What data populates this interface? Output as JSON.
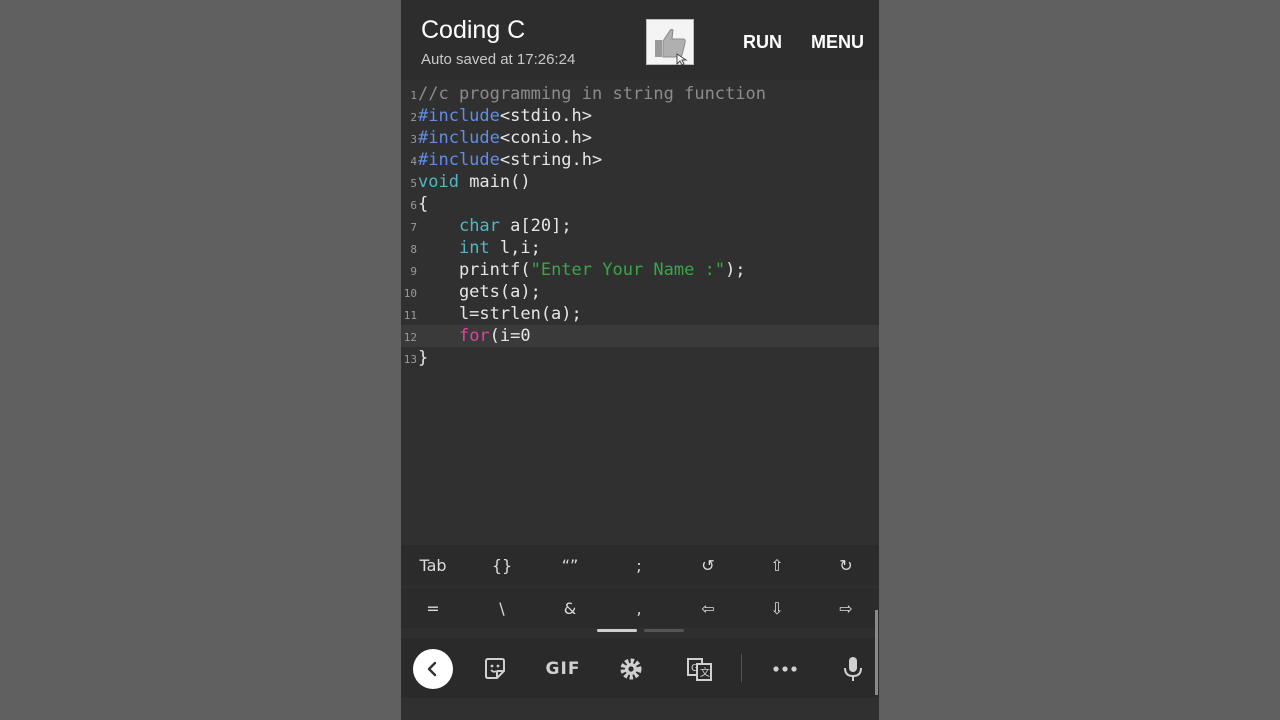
{
  "app": {
    "title": "Coding C",
    "autosave": "Auto saved at 17:26:24"
  },
  "toolbar": {
    "like_icon": "thumbs-up-icon",
    "run_label": "RUN",
    "menu_label": "MENU"
  },
  "editor": {
    "current_line": 12,
    "lines": [
      {
        "n": "1",
        "tokens": [
          {
            "c": "comment",
            "t": "//c programming in string function"
          }
        ]
      },
      {
        "n": "2",
        "tokens": [
          {
            "c": "pre",
            "t": "#include"
          },
          {
            "c": "plain",
            "t": "<stdio.h>"
          }
        ]
      },
      {
        "n": "3",
        "tokens": [
          {
            "c": "pre",
            "t": "#include"
          },
          {
            "c": "plain",
            "t": "<conio.h>"
          }
        ]
      },
      {
        "n": "4",
        "tokens": [
          {
            "c": "pre",
            "t": "#include"
          },
          {
            "c": "plain",
            "t": "<string.h>"
          }
        ]
      },
      {
        "n": "5",
        "tokens": [
          {
            "c": "type",
            "t": "void"
          },
          {
            "c": "plain",
            "t": " main()"
          }
        ]
      },
      {
        "n": "6",
        "tokens": [
          {
            "c": "plain",
            "t": "{"
          }
        ]
      },
      {
        "n": "7",
        "tokens": [
          {
            "c": "plain",
            "t": "    "
          },
          {
            "c": "type",
            "t": "char"
          },
          {
            "c": "plain",
            "t": " a[20];"
          }
        ]
      },
      {
        "n": "8",
        "tokens": [
          {
            "c": "plain",
            "t": "    "
          },
          {
            "c": "type",
            "t": "int"
          },
          {
            "c": "plain",
            "t": " l,i;"
          }
        ]
      },
      {
        "n": "9",
        "tokens": [
          {
            "c": "plain",
            "t": "    printf("
          },
          {
            "c": "str",
            "t": "\"Enter Your Name :\""
          },
          {
            "c": "plain",
            "t": ");"
          }
        ]
      },
      {
        "n": "10",
        "tokens": [
          {
            "c": "plain",
            "t": "    gets(a);"
          }
        ]
      },
      {
        "n": "11",
        "tokens": [
          {
            "c": "plain",
            "t": "    l=strlen(a);"
          }
        ]
      },
      {
        "n": "12",
        "tokens": [
          {
            "c": "plain",
            "t": "    "
          },
          {
            "c": "kw",
            "t": "for"
          },
          {
            "c": "plain",
            "t": "(i=0"
          }
        ]
      },
      {
        "n": "13",
        "tokens": [
          {
            "c": "plain",
            "t": "}"
          }
        ]
      }
    ]
  },
  "symbol_keys": {
    "row1": [
      {
        "label": "Tab",
        "name": "key-tab"
      },
      {
        "label": "{}",
        "name": "key-braces"
      },
      {
        "label": "“”",
        "name": "key-quotes"
      },
      {
        "label": ";",
        "name": "key-semicolon"
      },
      {
        "label": "↺",
        "name": "key-undo"
      },
      {
        "label": "⇧",
        "name": "key-up"
      },
      {
        "label": "↻",
        "name": "key-redo"
      }
    ],
    "row2": [
      {
        "label": "=",
        "name": "key-equals"
      },
      {
        "label": "\\",
        "name": "key-backslash"
      },
      {
        "label": "&",
        "name": "key-ampersand"
      },
      {
        "label": ",",
        "name": "key-comma"
      },
      {
        "label": "⇦",
        "name": "key-left"
      },
      {
        "label": "⇩",
        "name": "key-down"
      },
      {
        "label": "⇨",
        "name": "key-right"
      }
    ]
  },
  "keyboard_toolbar": {
    "back_icon": "chevron-left-icon",
    "sticker_icon": "sticker-icon",
    "gif_label": "GIF",
    "settings_icon": "gear-icon",
    "translate_icon": "translate-icon",
    "more_icon": "more-horizontal-icon",
    "mic_icon": "microphone-icon"
  },
  "colors": {
    "comment": "#8c8c8c",
    "preprocessor": "#5f8ee6",
    "type": "#4fb8c4",
    "string": "#3aa54b",
    "keyword": "#e0439c",
    "plain": "#e6e6e6"
  }
}
